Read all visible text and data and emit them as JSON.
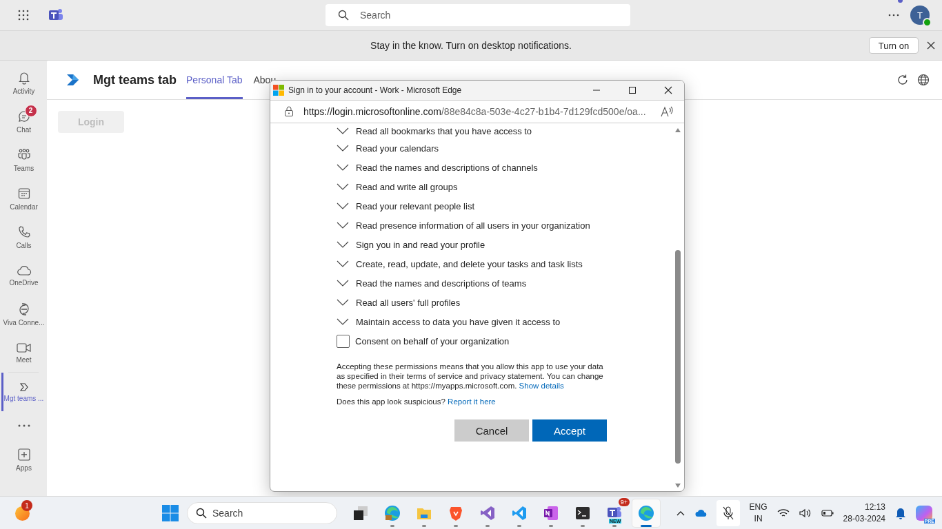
{
  "top_bar": {
    "search": {
      "placeholder": "Search"
    },
    "avatar_initial": "T"
  },
  "notification_bar": {
    "message": "Stay in the know. Turn on desktop notifications.",
    "button": "Turn on"
  },
  "rail": [
    {
      "kind": "bell",
      "label": "Activity",
      "selected": false
    },
    {
      "kind": "chat",
      "label": "Chat",
      "badge": "2",
      "selected": false
    },
    {
      "kind": "teams",
      "label": "Teams",
      "selected": false
    },
    {
      "kind": "calendar",
      "label": "Calendar",
      "selected": false
    },
    {
      "kind": "phone",
      "label": "Calls",
      "selected": false
    },
    {
      "kind": "cloud",
      "label": "OneDrive",
      "selected": false
    },
    {
      "kind": "viva",
      "label": "Viva Conne...",
      "selected": false
    },
    {
      "kind": "video",
      "label": "Meet",
      "selected": false
    },
    {
      "kind": "app",
      "label": "Mgt teams ...",
      "selected": true
    },
    {
      "kind": "more",
      "selected": false
    },
    {
      "kind": "apps",
      "label": "Apps",
      "selected": false
    }
  ],
  "app": {
    "title": "Mgt teams tab",
    "tabs": [
      {
        "label": "Personal Tab",
        "selected": true
      },
      {
        "label": "Abou",
        "selected": false
      }
    ],
    "login_button": "Login"
  },
  "popup": {
    "title": "Sign in to your account - Work - Microsoft Edge",
    "url_host": "https://login.microsoftonline.com",
    "url_rest": "/88e84c8a-503e-4c27-b1b4-7d129fcd500e/oa...",
    "permissions": [
      "Read all bookmarks that you have access to",
      "Read your calendars",
      "Read the names and descriptions of channels",
      "Read and write all groups",
      "Read your relevant people list",
      "Read presence information of all users in your organization",
      "Sign you in and read your profile",
      "Create, read, update, and delete your tasks and task lists",
      "Read the names and descriptions of teams",
      "Read all users' full profiles",
      "Maintain access to data you have given it access to"
    ],
    "consent": {
      "label": "Consent on behalf of your organization",
      "checked": false
    },
    "notice": "Accepting these permissions means that you allow this app to use your data as specified in their terms of service and privacy statement. You can change these permissions at https://myapps.microsoft.com.",
    "notice_link": "Show details",
    "suspicious": "Does this app look suspicious?",
    "report_link": "Report it here",
    "buttons": [
      {
        "kind": "secondary",
        "label": "Cancel"
      },
      {
        "kind": "primary",
        "label": "Accept"
      }
    ]
  },
  "taskbar": {
    "weather_badge": "1",
    "search": {
      "placeholder": "Search"
    },
    "apps": [
      {
        "kind": "taskview",
        "running": false,
        "selected": false
      },
      {
        "kind": "edgework",
        "running": true,
        "selected": false
      },
      {
        "kind": "folder",
        "running": true,
        "selected": false
      },
      {
        "kind": "brave",
        "running": true,
        "selected": false
      },
      {
        "kind": "vs",
        "running": true,
        "selected": false
      },
      {
        "kind": "vscode",
        "running": true,
        "selected": false
      },
      {
        "kind": "onenote",
        "running": true,
        "selected": false
      },
      {
        "kind": "terminal",
        "running": true,
        "selected": false
      },
      {
        "kind": "teams",
        "badge": "9+",
        "tag": "NEW",
        "running": true,
        "selected": false
      },
      {
        "kind": "edge",
        "running": true,
        "selected": true
      }
    ],
    "language": [
      "ENG",
      "IN"
    ],
    "time": "12:13",
    "date": "28-03-2024",
    "copilot_tag": "PRE"
  }
}
